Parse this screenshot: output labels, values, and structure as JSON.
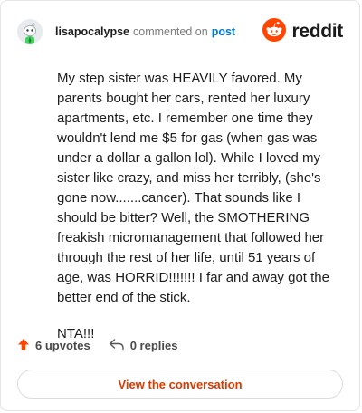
{
  "header": {
    "username": "lisapocalypse",
    "action_text": "commented on",
    "post_link": "post",
    "brand": "reddit",
    "avatar_icon": "snoo-avatar-icon",
    "logo_icon": "reddit-alien-icon",
    "brand_color": "#ff4500"
  },
  "comment": {
    "paragraphs": [
      "My step sister was HEAVILY favored. My parents bought her cars, rented her luxury apartments, etc. I remember one time they wouldn't lend me $5 for gas (when gas was under a dollar a gallon lol). While I loved my sister like crazy, and miss her terribly, (she's gone now.......cancer). That sounds like I should be bitter? Well, the SMOTHERING freakish micromanagement that followed her through the rest of her life, until 51 years of age, was HORRID!!!!!!! I far and away got the better end of the stick.",
      "NTA!!!"
    ]
  },
  "stats": {
    "upvotes": "6 upvotes",
    "replies": "0 replies",
    "upvote_icon": "upvote-arrow-icon",
    "reply_icon": "reply-arrow-icon"
  },
  "footer": {
    "button_label": "View the conversation"
  }
}
